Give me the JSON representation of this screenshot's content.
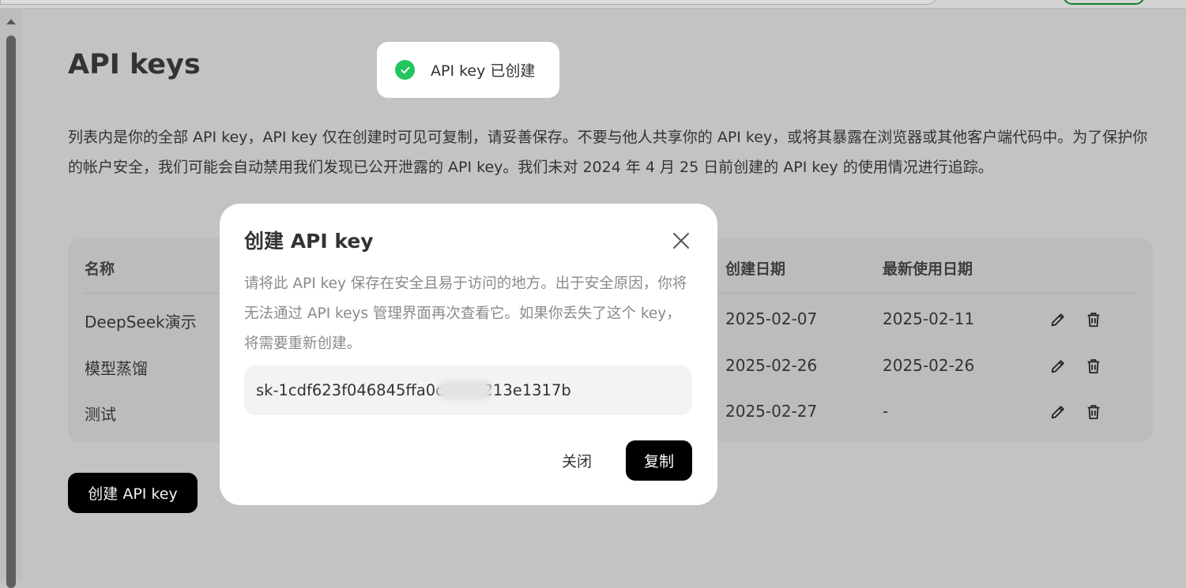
{
  "page": {
    "title": "API keys",
    "description": "列表内是你的全部 API key，API key 仅在创建时可见可复制，请妥善保存。不要与他人共享你的 API key，或将其暴露在浏览器或其他客户端代码中。为了保护你的帐户安全，我们可能会自动禁用我们发现已公开泄露的 API key。我们未对 2024 年 4 月 25 日前创建的 API key 的使用情况进行追踪。",
    "create_button": "创建 API key"
  },
  "toast": {
    "text": "API key 已创建",
    "icon": "check-circle-icon",
    "color": "#22c55e"
  },
  "table": {
    "headers": {
      "name": "名称",
      "created": "创建日期",
      "last_used": "最新使用日期"
    },
    "rows": [
      {
        "name": "DeepSeek演示",
        "created": "2025-02-07",
        "last_used": "2025-02-11"
      },
      {
        "name": "模型蒸馏",
        "created": "2025-02-26",
        "last_used": "2025-02-26"
      },
      {
        "name": "测试",
        "created": "2025-02-27",
        "last_used": "-"
      }
    ],
    "row_actions": [
      "pencil-icon",
      "trash-icon"
    ]
  },
  "modal": {
    "title": "创建 API key",
    "description": "请将此 API key 保存在安全且易于访问的地方。出于安全原因，你将无法通过 API keys 管理界面再次查看它。如果你丢失了这个 key，将需要重新创建。",
    "key_value": "sk-1cdf623f046845ffa0c8387213e1317b",
    "close_label": "关闭",
    "copy_label": "复制",
    "close_icon": "close-icon"
  }
}
